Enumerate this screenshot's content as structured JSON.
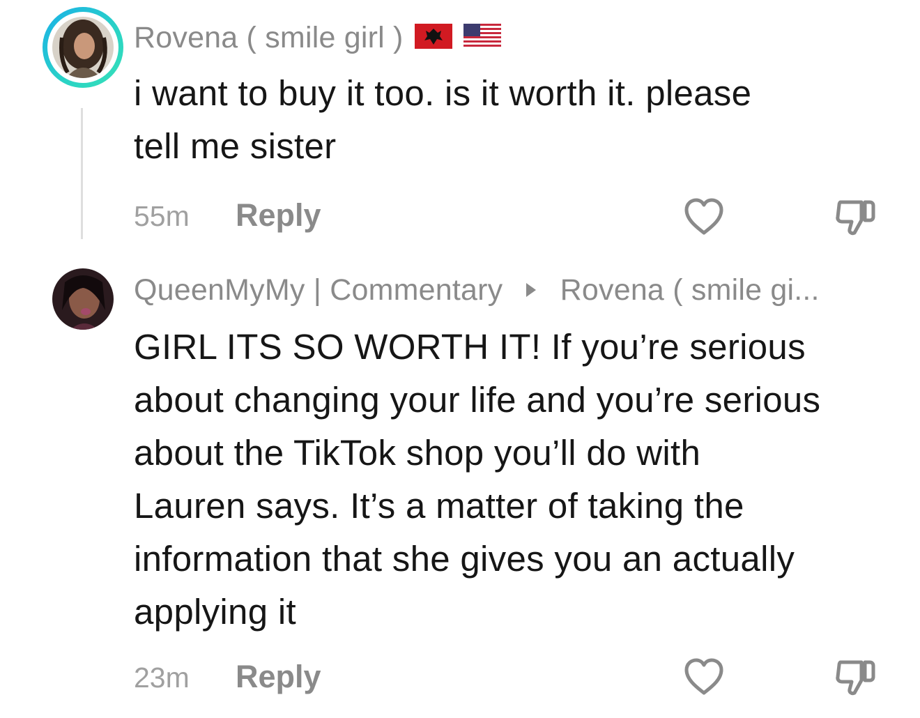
{
  "comments": [
    {
      "username": "Rovena ( smile girl )",
      "flags": [
        "albania-flag",
        "usa-flag"
      ],
      "text_lines": [
        "i want to buy it too. is it worth it. please",
        "tell me sister"
      ],
      "time": "55m",
      "reply_label": "Reply"
    },
    {
      "username": "QueenMyMy | Commentary",
      "reply_to": "Rovena ( smile gi...",
      "text_lines": [
        "GIRL ITS SO WORTH IT! If you’re serious",
        "about changing your life and you’re serious",
        "about the TikTok shop you’ll do with",
        "Lauren says. It’s a matter of taking the",
        "information that she gives you an actually",
        "applying it"
      ],
      "time": "23m",
      "reply_label": "Reply"
    }
  ],
  "colors": {
    "ring_start": "#1ab0e8",
    "ring_end": "#36e0b8",
    "username": "#8a8a8a",
    "text": "#161616",
    "meta": "#a0a0a0"
  }
}
